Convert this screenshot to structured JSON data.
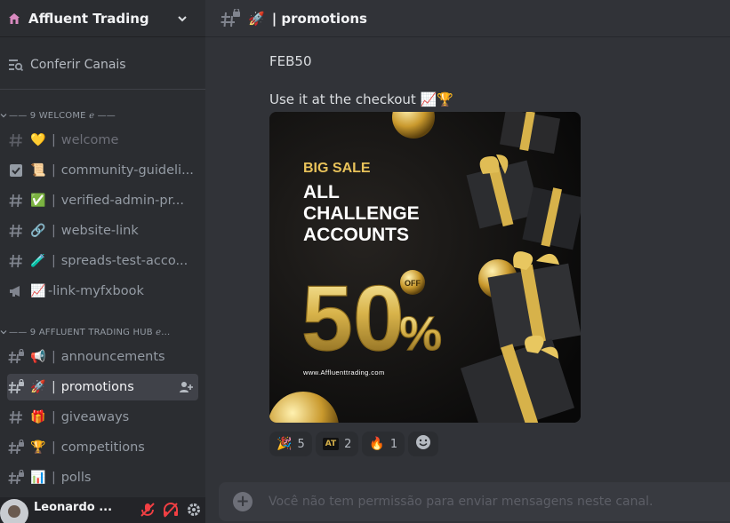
{
  "server": {
    "name": "Affluent Trading",
    "icon": "house-icon"
  },
  "sidebar": {
    "browse_label": "Conferir Canais",
    "categories": [
      {
        "label": "—— 9 WELCOME ℯ ——"
      },
      {
        "label": "—— 9 AFFLUENT TRADING HUB ℯ..."
      }
    ],
    "channels": [
      {
        "emoji": "💛",
        "sep": "|",
        "name": "welcome"
      },
      {
        "emoji": "📜",
        "sep": "|",
        "name": "community-guideli..."
      },
      {
        "emoji": "✅",
        "sep": "|",
        "name": "verified-admin-pr..."
      },
      {
        "emoji": "🔗",
        "sep": "|",
        "name": "website-link"
      },
      {
        "emoji": "🧪",
        "sep": "|",
        "name": "spreads-test-acco..."
      },
      {
        "emoji": "📈",
        "sep": "",
        "name": "-link-myfxbook"
      },
      {
        "emoji": "📢",
        "sep": "|",
        "name": "announcements"
      },
      {
        "emoji": "🚀",
        "sep": "|",
        "name": "promotions"
      },
      {
        "emoji": "🎁",
        "sep": "|",
        "name": "giveaways"
      },
      {
        "emoji": "🏆",
        "sep": "|",
        "name": "competitions"
      },
      {
        "emoji": "📊",
        "sep": "|",
        "name": "polls"
      }
    ]
  },
  "user": {
    "name": "Leonardo ..."
  },
  "channel_header": {
    "emoji": "🚀",
    "title": "| promotions"
  },
  "messages": {
    "line1": "FEB50",
    "line2": "Use it at the checkout 📈🏆"
  },
  "promo_image": {
    "headline_small": "BIG SALE",
    "headline_l1": "ALL",
    "headline_l2": "CHALLENGE",
    "headline_l3": "ACCOUNTS",
    "big_number": "50",
    "percent": "%",
    "off_badge": "OFF",
    "website": "www.Affluenttrading.com"
  },
  "reactions": [
    {
      "emoji": "🎉",
      "count": "5"
    },
    {
      "emoji": "AT",
      "count": "2"
    },
    {
      "emoji": "🔥",
      "count": "1"
    }
  ],
  "composer": {
    "placeholder": "Você não tem permissão para enviar mensagens neste canal."
  },
  "colors": {
    "sidebar_bg": "#2b2d31",
    "main_bg": "#313338",
    "gold": "#d4af37",
    "active_item": "#404249"
  }
}
